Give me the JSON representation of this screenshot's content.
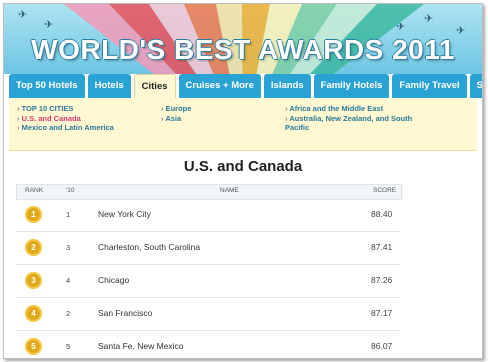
{
  "banner": {
    "title": "WORLD'S BEST AWARDS 2011"
  },
  "tabs": [
    {
      "label": "Top 50 Hotels",
      "active": false
    },
    {
      "label": "Hotels",
      "active": false
    },
    {
      "label": "Cities",
      "active": true
    },
    {
      "label": "Cruises + More",
      "active": false
    },
    {
      "label": "Islands",
      "active": false
    },
    {
      "label": "Family Hotels",
      "active": false
    },
    {
      "label": "Family Travel",
      "active": false
    },
    {
      "label": "Spas",
      "active": false
    }
  ],
  "subnav": {
    "col1": [
      "TOP 10 CITIES",
      "U.S. and Canada",
      "Mexico and Latin America"
    ],
    "col2": [
      "Europe",
      "Asia"
    ],
    "col3": [
      "Africa and the Middle East",
      "Australia, New Zealand, and South Pacific"
    ]
  },
  "heading": "U.S. and Canada",
  "table": {
    "headers": {
      "rank": "RANK",
      "prev": "'10",
      "name": "NAME",
      "score": "SCORE"
    },
    "rows": [
      {
        "rank": "1",
        "prev": "1",
        "name": "New York City",
        "score": "88.40"
      },
      {
        "rank": "2",
        "prev": "3",
        "name": "Charleston, South Carolina",
        "score": "87.41"
      },
      {
        "rank": "3",
        "prev": "4",
        "name": "Chicago",
        "score": "87.26"
      },
      {
        "rank": "4",
        "prev": "2",
        "name": "San Francisco",
        "score": "87.17"
      },
      {
        "rank": "5",
        "prev": "5",
        "name": "Santa Fe, New Mexico",
        "score": "86.07"
      }
    ]
  },
  "colors": {
    "tab": "#2aa3d4",
    "subnav_bg": "#fff8d2",
    "link": "#2b7a9a",
    "link_active": "#d93b6f",
    "badge": "#e0a91a"
  }
}
